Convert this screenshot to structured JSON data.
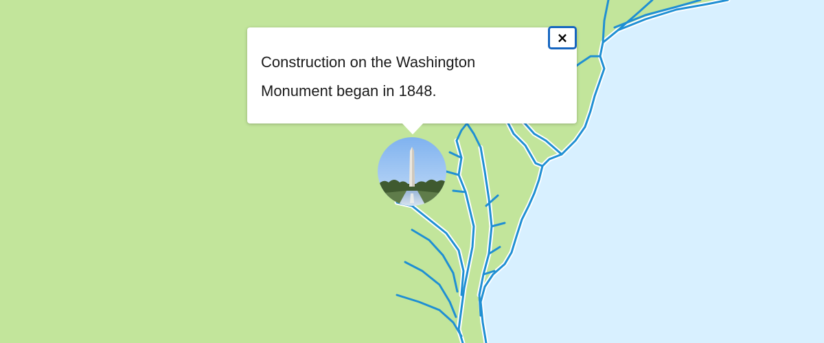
{
  "popup": {
    "text": "Construction on the Washington Monument began in 1848.",
    "close_label": "×"
  },
  "marker": {
    "image_subject": "washington-monument-photo"
  },
  "colors": {
    "land": "#c2e59b",
    "water": "#d8f0ff",
    "shoreline": "#1f8fd3",
    "shore_halo": "#ffffff",
    "popup_bg": "#ffffff",
    "close_border": "#1565c0"
  }
}
